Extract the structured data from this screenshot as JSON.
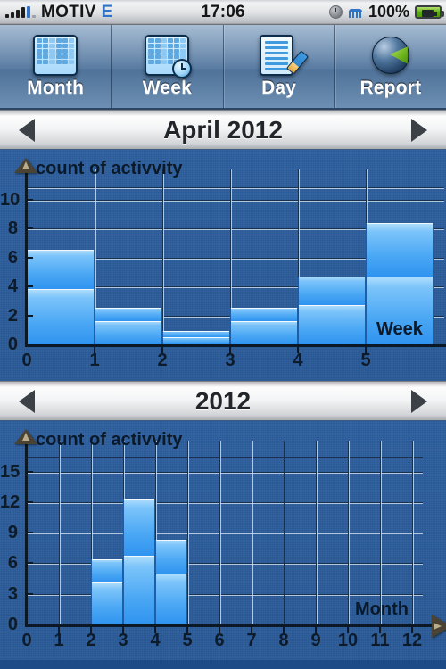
{
  "status_bar": {
    "signal_icon": "signal-bars-icon",
    "carrier": "MOTIV",
    "network": "E",
    "time": "17:06",
    "alarm_icon": "alarm-clock-icon",
    "tty_icon": "tty-icon",
    "battery_percent": "100%",
    "battery_icon": "battery-charging-icon"
  },
  "toolbar": {
    "buttons": [
      {
        "label": "Month",
        "icon": "calendar-month-icon"
      },
      {
        "label": "Week",
        "icon": "calendar-week-clock-icon"
      },
      {
        "label": "Day",
        "icon": "note-pencil-icon"
      },
      {
        "label": "Report",
        "icon": "pie-chart-icon"
      }
    ]
  },
  "week_nav": {
    "prev_icon": "triangle-left-icon",
    "title": "April 2012",
    "next_icon": "triangle-right-icon"
  },
  "year_nav": {
    "prev_icon": "triangle-left-icon",
    "title": "2012",
    "next_icon": "triangle-right-icon"
  },
  "colors": {
    "chart_background": "#2d5f9e",
    "bar_fill_light": "#b3dffc",
    "bar_fill_dark": "#2f93ef",
    "gridline_dark": "#17324f",
    "gridline_light": "#e1ebf5",
    "axis": "#0b1926",
    "toolbar_top": "#8aa6c4",
    "accent_blue": "#2f74c8"
  },
  "chart_data": [
    {
      "id": "week-chart",
      "type": "bar",
      "title": "April 2012",
      "ylabel": "count of activvity",
      "xlabel": "Week",
      "categories": [
        "1",
        "2",
        "3",
        "4",
        "5"
      ],
      "bar_spans": [
        [
          0,
          1
        ],
        [
          1,
          2
        ],
        [
          2,
          3
        ],
        [
          3,
          4
        ],
        [
          4,
          5
        ],
        [
          5,
          6
        ]
      ],
      "values": [
        6.5,
        2.5,
        0.9,
        2.5,
        4.7,
        8.4
      ],
      "stack_breaks": [
        [
          3.8
        ],
        [
          1.6
        ],
        [
          0.5
        ],
        [
          1.6
        ],
        [
          2.7
        ],
        [
          4.7
        ]
      ],
      "xlim": [
        0,
        6
      ],
      "ylim": [
        0,
        11.2
      ],
      "yticks": [
        0,
        2,
        4,
        6,
        8,
        10
      ],
      "ytick_labels": [
        "0",
        "2",
        "4",
        "6",
        "8",
        "10"
      ],
      "xticks": [
        0,
        1,
        2,
        3,
        4,
        5
      ],
      "xtick_labels": [
        "0",
        "1",
        "2",
        "3",
        "4",
        "5"
      ],
      "grid": true,
      "legend": false
    },
    {
      "id": "year-chart",
      "type": "bar",
      "title": "2012",
      "ylabel": "count of activvity",
      "xlabel": "Month",
      "categories": [
        "1",
        "2",
        "3",
        "4",
        "5",
        "6",
        "7",
        "8",
        "9",
        "10",
        "11",
        "12"
      ],
      "bar_spans": [
        [
          2,
          3
        ],
        [
          3,
          4
        ],
        [
          4,
          5
        ]
      ],
      "values": [
        6.4,
        12.3,
        8.3
      ],
      "stack_breaks": [
        [
          4.1
        ],
        [
          6.7
        ],
        [
          5.0
        ]
      ],
      "xlim": [
        0,
        12
      ],
      "ylim": [
        0,
        16.8
      ],
      "yticks": [
        0,
        3,
        6,
        9,
        12,
        15
      ],
      "ytick_labels": [
        "0",
        "3",
        "6",
        "9",
        "12",
        "15"
      ],
      "xticks": [
        0,
        1,
        2,
        3,
        4,
        5,
        6,
        7,
        8,
        9,
        10,
        11,
        12
      ],
      "xtick_labels": [
        "0",
        "1",
        "2",
        "3",
        "4",
        "5",
        "6",
        "7",
        "8",
        "9",
        "10",
        "11",
        "12"
      ],
      "grid": true,
      "legend": false
    }
  ]
}
